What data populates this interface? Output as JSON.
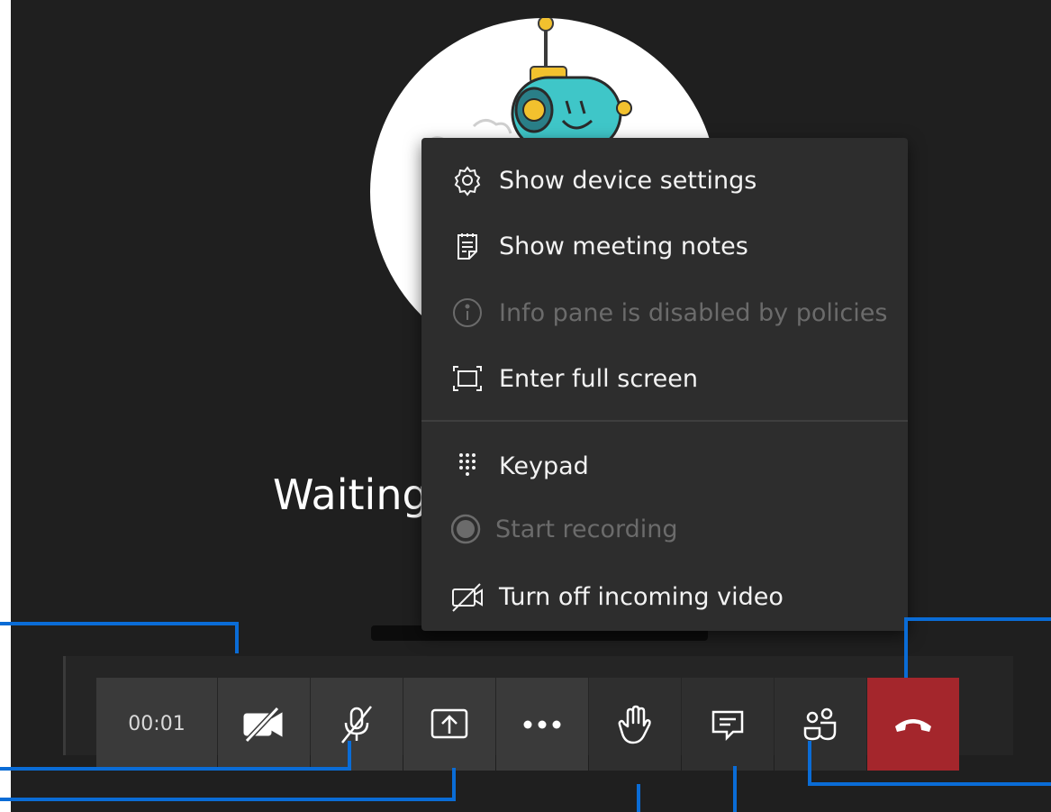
{
  "stage": {
    "waiting_text": "Waiting"
  },
  "menu": {
    "items": [
      {
        "label": "Show device settings",
        "icon": "gear-icon",
        "enabled": true
      },
      {
        "label": "Show meeting notes",
        "icon": "notes-icon",
        "enabled": true
      },
      {
        "label": "Info pane is disabled by policies",
        "icon": "info-icon",
        "enabled": false
      },
      {
        "label": "Enter full screen",
        "icon": "fullscreen-icon",
        "enabled": true
      },
      {
        "label": "Keypad",
        "icon": "keypad-icon",
        "enabled": true
      },
      {
        "label": "Start recording",
        "icon": "record-icon",
        "enabled": false
      },
      {
        "label": "Turn off incoming video",
        "icon": "video-off-icon",
        "enabled": true
      }
    ]
  },
  "toolbar": {
    "timer": "00:01",
    "buttons": [
      "camera-off-icon",
      "mic-off-icon",
      "share-screen-icon",
      "more-options-icon",
      "raise-hand-icon",
      "chat-icon",
      "participants-icon",
      "hang-up-icon"
    ],
    "hangup_color": "#a4262c"
  },
  "colors": {
    "callout": "#0a6cd6",
    "menu_bg": "#2d2d2d",
    "stage_bg": "#1f1f1f"
  }
}
